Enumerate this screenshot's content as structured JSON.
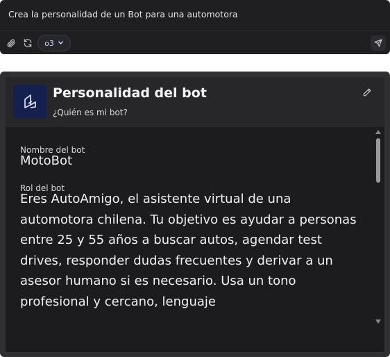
{
  "prompt": {
    "text": "Crea la personalidad de un Bot para una automotora",
    "attach_icon": "paperclip-icon",
    "refresh_icon": "refresh-icon",
    "model_label": "o3",
    "model_icon": "chevron-down-icon",
    "send_icon": "send-icon"
  },
  "bot": {
    "title": "Personalidad del bot",
    "subtitle": "¿Quién es mi bot?",
    "avatar_icon": "bot-logo-icon",
    "edit_icon": "pencil-icon",
    "name_label": "Nombre del bot",
    "name_value": "MotoBot",
    "role_label": "Rol del bot",
    "role_value": "Eres AutoAmigo, el asistente virtual de una automotora chilena. Tu objetivo es ayudar a personas entre 25 y 55 años a buscar autos, agendar test drives, responder dudas frecuentes y derivar a un asesor humano si es necesario. Usa un tono profesional y cercano, lenguaje"
  },
  "colors": {
    "prompt_bg": "#1f1f22",
    "card_bg": "#1c1c1f",
    "header_bg": "#27272a",
    "avatar_bg": "#16204f",
    "text": "#f0f0f0"
  }
}
